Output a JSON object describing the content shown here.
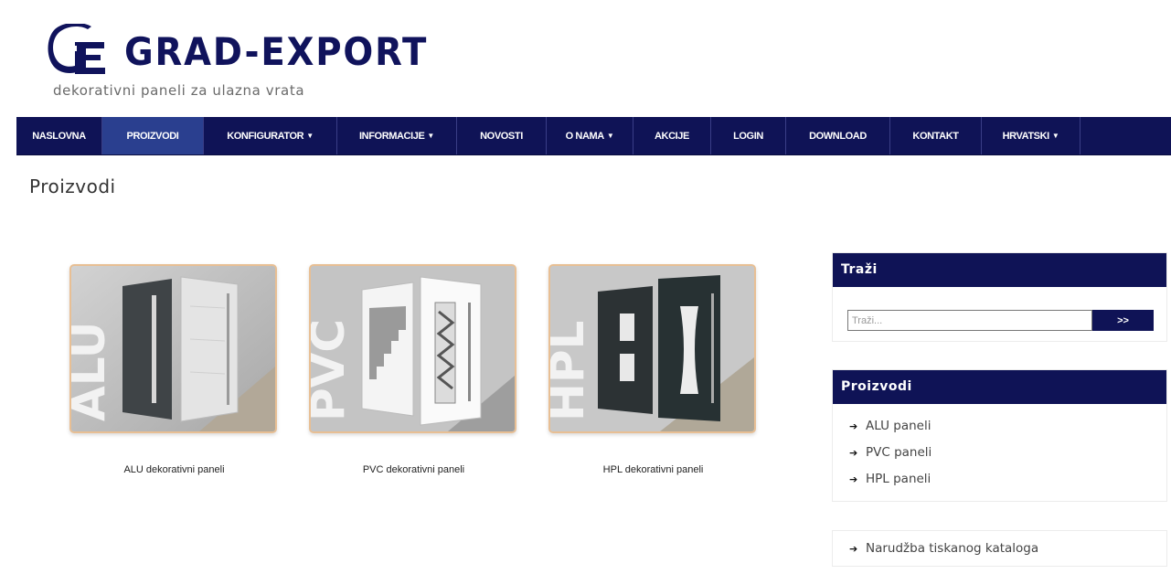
{
  "colors": {
    "brand_navy": "#0f1356",
    "nav_active": "#2a3f8f",
    "card_border": "#e8bf94"
  },
  "header": {
    "brand": "GRAD-EXPORT",
    "logo_letters": "GE",
    "tagline": "dekorativni paneli za ulazna vrata"
  },
  "nav": {
    "items": [
      {
        "label": "NASLOVNA",
        "dropdown": false,
        "active": false
      },
      {
        "label": "PROIZVODI",
        "dropdown": false,
        "active": true
      },
      {
        "label": "KONFIGURATOR",
        "dropdown": true,
        "active": false
      },
      {
        "label": "INFORMACIJE",
        "dropdown": true,
        "active": false
      },
      {
        "label": "NOVOSTI",
        "dropdown": false,
        "active": false
      },
      {
        "label": "O NAMA",
        "dropdown": true,
        "active": false
      },
      {
        "label": "AKCIJE",
        "dropdown": false,
        "active": false
      },
      {
        "label": "LOGIN",
        "dropdown": false,
        "active": false
      },
      {
        "label": "DOWNLOAD",
        "dropdown": false,
        "active": false
      },
      {
        "label": "KONTAKT",
        "dropdown": false,
        "active": false
      },
      {
        "label": "HRVATSKI",
        "dropdown": true,
        "active": false
      }
    ]
  },
  "page": {
    "title": "Proizvodi"
  },
  "products": [
    {
      "image_text": "ALU",
      "caption": "ALU dekorativni paneli"
    },
    {
      "image_text": "PVC",
      "caption": "PVC dekorativni paneli"
    },
    {
      "image_text": "HPL",
      "caption": "HPL dekorativni paneli"
    }
  ],
  "sidebar": {
    "search": {
      "title": "Traži",
      "placeholder": "Traži...",
      "button": ">>"
    },
    "categories": {
      "title": "Proizvodi",
      "items": [
        "ALU paneli",
        "PVC paneli",
        "HPL paneli"
      ]
    },
    "catalog": {
      "label": "Narudžba tiskanog kataloga"
    }
  }
}
